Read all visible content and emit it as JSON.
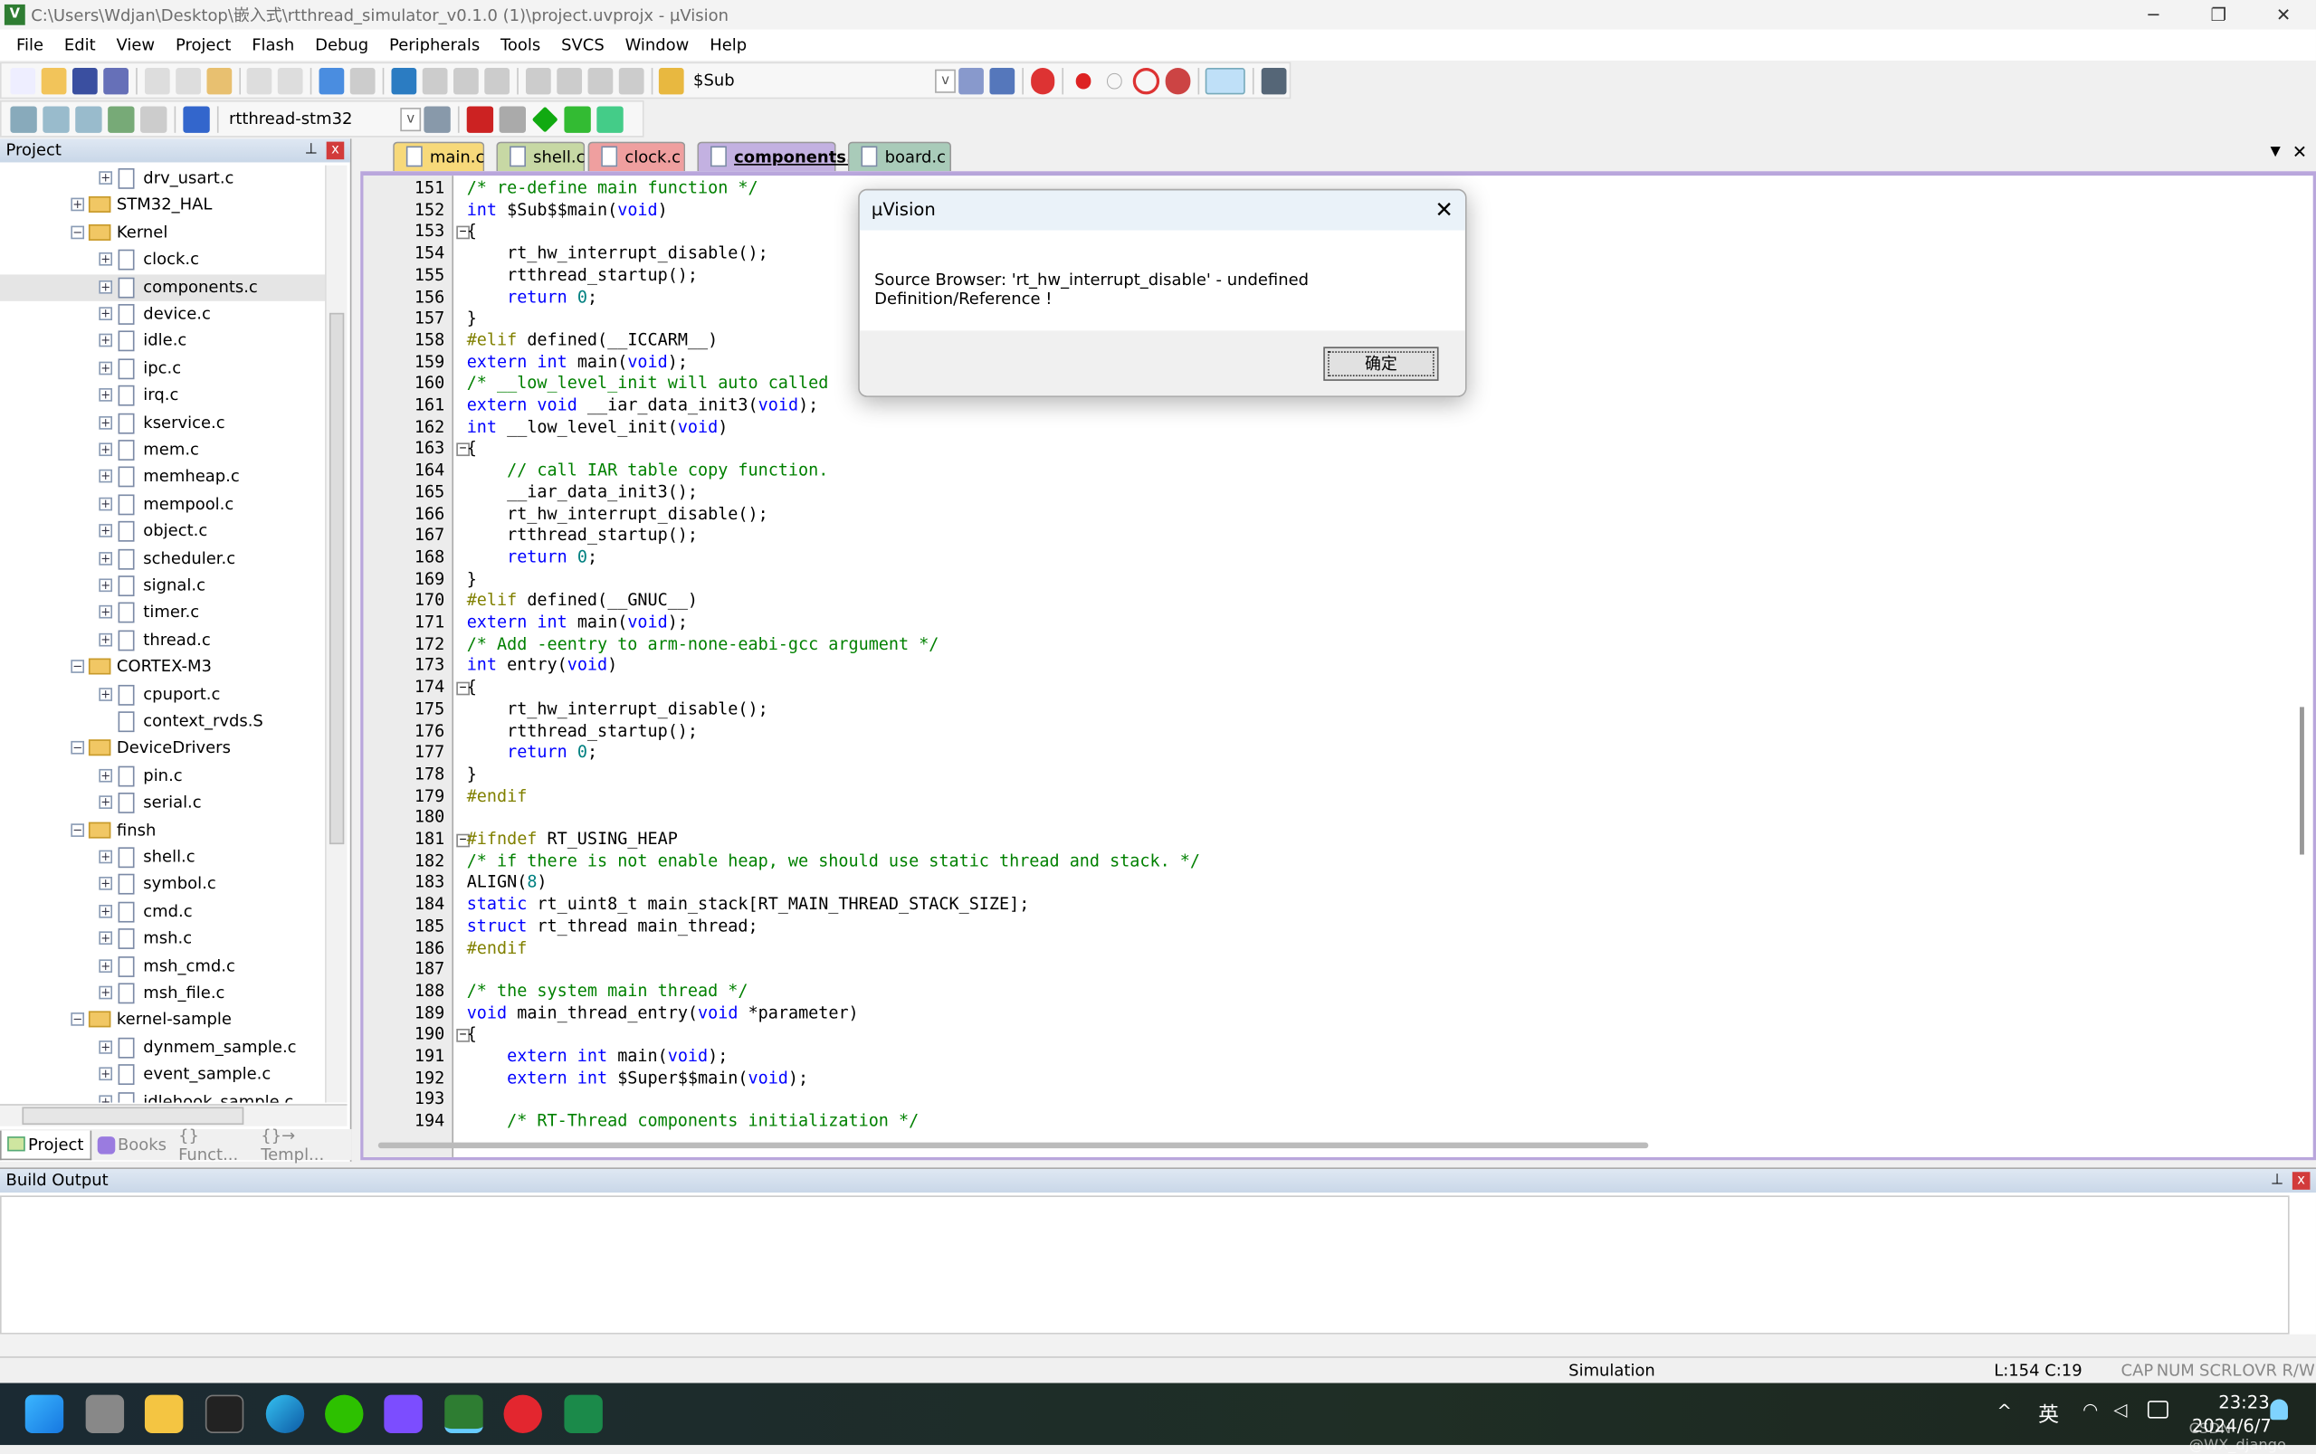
{
  "window": {
    "title": "C:\\Users\\Wdjan\\Desktop\\嵌入式\\rtthread_simulator_v0.1.0 (1)\\project.uvprojx - µVision",
    "minimize": "─",
    "maximize": "❐",
    "close": "✕"
  },
  "menu": [
    "File",
    "Edit",
    "View",
    "Project",
    "Flash",
    "Debug",
    "Peripherals",
    "Tools",
    "SVCS",
    "Window",
    "Help"
  ],
  "toolbar": {
    "find_combo": "$Sub",
    "target_combo": "rtthread-stm32"
  },
  "project_panel": {
    "title": "Project",
    "tabs": [
      "Project",
      "Books",
      "{} Funct...",
      "{}→ Templ..."
    ],
    "tree": [
      {
        "label": "drv_usart.c",
        "depth": 2,
        "type": "file",
        "exp": "+"
      },
      {
        "label": "STM32_HAL",
        "depth": 1,
        "type": "folder",
        "exp": "+"
      },
      {
        "label": "Kernel",
        "depth": 1,
        "type": "folder",
        "exp": "-"
      },
      {
        "label": "clock.c",
        "depth": 2,
        "type": "file",
        "exp": "+"
      },
      {
        "label": "components.c",
        "depth": 2,
        "type": "file",
        "exp": "+",
        "selected": true
      },
      {
        "label": "device.c",
        "depth": 2,
        "type": "file",
        "exp": "+"
      },
      {
        "label": "idle.c",
        "depth": 2,
        "type": "file",
        "exp": "+"
      },
      {
        "label": "ipc.c",
        "depth": 2,
        "type": "file",
        "exp": "+"
      },
      {
        "label": "irq.c",
        "depth": 2,
        "type": "file",
        "exp": "+"
      },
      {
        "label": "kservice.c",
        "depth": 2,
        "type": "file",
        "exp": "+"
      },
      {
        "label": "mem.c",
        "depth": 2,
        "type": "file",
        "exp": "+"
      },
      {
        "label": "memheap.c",
        "depth": 2,
        "type": "file",
        "exp": "+"
      },
      {
        "label": "mempool.c",
        "depth": 2,
        "type": "file",
        "exp": "+"
      },
      {
        "label": "object.c",
        "depth": 2,
        "type": "file",
        "exp": "+"
      },
      {
        "label": "scheduler.c",
        "depth": 2,
        "type": "file",
        "exp": "+"
      },
      {
        "label": "signal.c",
        "depth": 2,
        "type": "file",
        "exp": "+"
      },
      {
        "label": "timer.c",
        "depth": 2,
        "type": "file",
        "exp": "+"
      },
      {
        "label": "thread.c",
        "depth": 2,
        "type": "file",
        "exp": "+"
      },
      {
        "label": "CORTEX-M3",
        "depth": 1,
        "type": "folder",
        "exp": "-"
      },
      {
        "label": "cpuport.c",
        "depth": 2,
        "type": "file",
        "exp": "+"
      },
      {
        "label": "context_rvds.S",
        "depth": 2,
        "type": "file",
        "exp": ""
      },
      {
        "label": "DeviceDrivers",
        "depth": 1,
        "type": "folder",
        "exp": "-"
      },
      {
        "label": "pin.c",
        "depth": 2,
        "type": "file",
        "exp": "+"
      },
      {
        "label": "serial.c",
        "depth": 2,
        "type": "file",
        "exp": "+"
      },
      {
        "label": "finsh",
        "depth": 1,
        "type": "folder",
        "exp": "-"
      },
      {
        "label": "shell.c",
        "depth": 2,
        "type": "file",
        "exp": "+"
      },
      {
        "label": "symbol.c",
        "depth": 2,
        "type": "file",
        "exp": "+"
      },
      {
        "label": "cmd.c",
        "depth": 2,
        "type": "file",
        "exp": "+"
      },
      {
        "label": "msh.c",
        "depth": 2,
        "type": "file",
        "exp": "+"
      },
      {
        "label": "msh_cmd.c",
        "depth": 2,
        "type": "file",
        "exp": "+"
      },
      {
        "label": "msh_file.c",
        "depth": 2,
        "type": "file",
        "exp": "+"
      },
      {
        "label": "kernel-sample",
        "depth": 1,
        "type": "folder",
        "exp": "-"
      },
      {
        "label": "dynmem_sample.c",
        "depth": 2,
        "type": "file",
        "exp": "+"
      },
      {
        "label": "event_sample.c",
        "depth": 2,
        "type": "file",
        "exp": "+"
      },
      {
        "label": "idlehook_sample.c",
        "depth": 2,
        "type": "file",
        "exp": "+"
      }
    ]
  },
  "editor": {
    "tabs": [
      {
        "label": "main.c",
        "color": "#f7d97a"
      },
      {
        "label": "shell.c",
        "color": "#c7d8a4"
      },
      {
        "label": "clock.c",
        "color": "#ef9f9f"
      },
      {
        "label": "components.c",
        "color": "#c3b1e1",
        "active": true
      },
      {
        "label": "board.c",
        "color": "#a9cbb9"
      }
    ],
    "lines": [
      {
        "n": "151",
        "t": [
          [
            "c",
            "/* re-define main function */"
          ]
        ]
      },
      {
        "n": "152",
        "t": [
          [
            "k",
            "int"
          ],
          [
            "t",
            " $Sub$$main("
          ],
          [
            "k",
            "void"
          ],
          [
            "t",
            ")"
          ]
        ]
      },
      {
        "n": "153",
        "f": "-",
        "t": [
          [
            "t",
            "{"
          ]
        ]
      },
      {
        "n": "154",
        "t": [
          [
            "t",
            "    rt_hw_interrupt_disable();"
          ]
        ]
      },
      {
        "n": "155",
        "t": [
          [
            "t",
            "    rtthread_startup();"
          ]
        ]
      },
      {
        "n": "156",
        "t": [
          [
            "k",
            "    return"
          ],
          [
            "t",
            " "
          ],
          [
            "n",
            "0"
          ],
          [
            "t",
            ";"
          ]
        ]
      },
      {
        "n": "157",
        "t": [
          [
            "t",
            "}"
          ]
        ]
      },
      {
        "n": "158",
        "t": [
          [
            "p",
            "#elif"
          ],
          [
            "t",
            " defined(__ICCARM__)"
          ]
        ]
      },
      {
        "n": "159",
        "t": [
          [
            "k",
            "extern int"
          ],
          [
            "t",
            " main("
          ],
          [
            "k",
            "void"
          ],
          [
            "t",
            ");"
          ]
        ]
      },
      {
        "n": "160",
        "t": [
          [
            "c",
            "/* __low_level_init will auto called"
          ]
        ]
      },
      {
        "n": "161",
        "t": [
          [
            "k",
            "extern void"
          ],
          [
            "t",
            " __iar_data_init3("
          ],
          [
            "k",
            "void"
          ],
          [
            "t",
            ");"
          ]
        ]
      },
      {
        "n": "162",
        "t": [
          [
            "k",
            "int"
          ],
          [
            "t",
            " __low_level_init("
          ],
          [
            "k",
            "void"
          ],
          [
            "t",
            ")"
          ]
        ]
      },
      {
        "n": "163",
        "f": "-",
        "t": [
          [
            "t",
            "{"
          ]
        ]
      },
      {
        "n": "164",
        "t": [
          [
            "c",
            "    // call IAR table copy function."
          ]
        ]
      },
      {
        "n": "165",
        "t": [
          [
            "t",
            "    __iar_data_init3();"
          ]
        ]
      },
      {
        "n": "166",
        "t": [
          [
            "t",
            "    rt_hw_interrupt_disable();"
          ]
        ]
      },
      {
        "n": "167",
        "t": [
          [
            "t",
            "    rtthread_startup();"
          ]
        ]
      },
      {
        "n": "168",
        "t": [
          [
            "k",
            "    return"
          ],
          [
            "t",
            " "
          ],
          [
            "n",
            "0"
          ],
          [
            "t",
            ";"
          ]
        ]
      },
      {
        "n": "169",
        "t": [
          [
            "t",
            "}"
          ]
        ]
      },
      {
        "n": "170",
        "t": [
          [
            "p",
            "#elif"
          ],
          [
            "t",
            " defined(__GNUC__)"
          ]
        ]
      },
      {
        "n": "171",
        "t": [
          [
            "k",
            "extern int"
          ],
          [
            "t",
            " main("
          ],
          [
            "k",
            "void"
          ],
          [
            "t",
            ");"
          ]
        ]
      },
      {
        "n": "172",
        "t": [
          [
            "c",
            "/* Add -eentry to arm-none-eabi-gcc argument */"
          ]
        ]
      },
      {
        "n": "173",
        "t": [
          [
            "k",
            "int"
          ],
          [
            "t",
            " entry("
          ],
          [
            "k",
            "void"
          ],
          [
            "t",
            ")"
          ]
        ]
      },
      {
        "n": "174",
        "f": "-",
        "t": [
          [
            "t",
            "{"
          ]
        ]
      },
      {
        "n": "175",
        "t": [
          [
            "t",
            "    rt_hw_interrupt_disable();"
          ]
        ]
      },
      {
        "n": "176",
        "t": [
          [
            "t",
            "    rtthread_startup();"
          ]
        ]
      },
      {
        "n": "177",
        "t": [
          [
            "k",
            "    return"
          ],
          [
            "t",
            " "
          ],
          [
            "n",
            "0"
          ],
          [
            "t",
            ";"
          ]
        ]
      },
      {
        "n": "178",
        "t": [
          [
            "t",
            "}"
          ]
        ]
      },
      {
        "n": "179",
        "t": [
          [
            "p",
            "#endif"
          ]
        ]
      },
      {
        "n": "180",
        "t": []
      },
      {
        "n": "181",
        "f": "-",
        "t": [
          [
            "p",
            "#ifndef"
          ],
          [
            "t",
            " RT_USING_HEAP"
          ]
        ]
      },
      {
        "n": "182",
        "t": [
          [
            "c",
            "/* if there is not enable heap, we should use static thread and stack. */"
          ]
        ]
      },
      {
        "n": "183",
        "t": [
          [
            "t",
            "ALIGN("
          ],
          [
            "n",
            "8"
          ],
          [
            "t",
            ")"
          ]
        ]
      },
      {
        "n": "184",
        "t": [
          [
            "k",
            "static"
          ],
          [
            "t",
            " rt_uint8_t main_stack[RT_MAIN_THREAD_STACK_SIZE];"
          ]
        ]
      },
      {
        "n": "185",
        "t": [
          [
            "k",
            "struct"
          ],
          [
            "t",
            " rt_thread main_thread;"
          ]
        ]
      },
      {
        "n": "186",
        "t": [
          [
            "p",
            "#endif"
          ]
        ]
      },
      {
        "n": "187",
        "t": []
      },
      {
        "n": "188",
        "t": [
          [
            "c",
            "/* the system main thread */"
          ]
        ]
      },
      {
        "n": "189",
        "t": [
          [
            "k",
            "void"
          ],
          [
            "t",
            " main_thread_entry("
          ],
          [
            "k",
            "void"
          ],
          [
            "t",
            " *parameter)"
          ]
        ]
      },
      {
        "n": "190",
        "f": "-",
        "t": [
          [
            "t",
            "{"
          ]
        ]
      },
      {
        "n": "191",
        "t": [
          [
            "k",
            "    extern int"
          ],
          [
            "t",
            " main("
          ],
          [
            "k",
            "void"
          ],
          [
            "t",
            ");"
          ]
        ]
      },
      {
        "n": "192",
        "t": [
          [
            "k",
            "    extern int"
          ],
          [
            "t",
            " $Super$$main("
          ],
          [
            "k",
            "void"
          ],
          [
            "t",
            ");"
          ]
        ]
      },
      {
        "n": "193",
        "t": []
      },
      {
        "n": "194",
        "t": [
          [
            "c",
            "    /* RT-Thread components initialization */"
          ]
        ]
      }
    ]
  },
  "build_output": {
    "title": "Build Output"
  },
  "status": {
    "mode": "Simulation",
    "position": "L:154 C:19",
    "cap": "CAP",
    "num": "NUM",
    "scrl": "SCRL",
    "ovr": "OVR",
    "rw": "R/W"
  },
  "dialog": {
    "title": "µVision",
    "message": "Source Browser: 'rt_hw_interrupt_disable' - undefined Definition/Reference !",
    "ok": "确定",
    "close": "✕"
  },
  "taskbar": {
    "ime": "英",
    "chevron": "^",
    "time": "23:23",
    "date": "2024/6/7",
    "watermark": "CSDN @WX_django"
  }
}
